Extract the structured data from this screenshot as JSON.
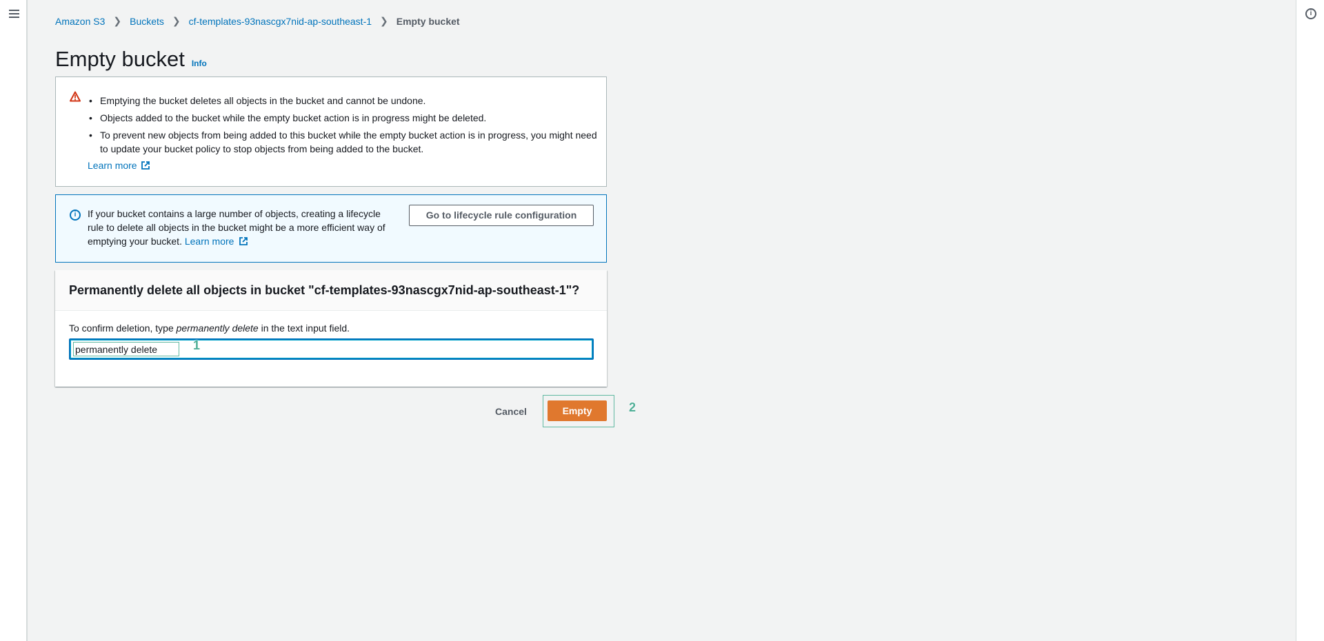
{
  "nav": {
    "menu_icon": "hamburger-menu-icon",
    "help_icon": "info-circle-icon"
  },
  "breadcrumb": [
    {
      "label": "Amazon S3"
    },
    {
      "label": "Buckets"
    },
    {
      "label": "cf-templates-93nascgx7nid-ap-southeast-1"
    },
    {
      "label": "Empty bucket"
    }
  ],
  "header": {
    "title": "Empty bucket",
    "info_link": "Info"
  },
  "warning": {
    "icon": "warning-triangle-icon",
    "items": [
      "Emptying the bucket deletes all objects in the bucket and cannot be undone.",
      "Objects added to the bucket while the empty bucket action is in progress might be deleted.",
      "To prevent new objects from being added to this bucket while the empty bucket action is in progress, you might need to update your bucket policy to stop objects from being added to the bucket."
    ],
    "learn_more": "Learn more"
  },
  "info": {
    "icon": "info-circle-icon",
    "text": "If your bucket contains a large number of objects, creating a lifecycle rule to delete all objects in the bucket might be a more efficient way of emptying your bucket.",
    "learn_more": "Learn more",
    "button_label": "Go to lifecycle rule configuration"
  },
  "confirm_panel": {
    "title": "Permanently delete all objects in bucket \"cf-templates-93nascgx7nid-ap-southeast-1\"?",
    "label_prefix": "To confirm deletion, type ",
    "label_emphasis": "permanently delete",
    "label_suffix": " in the text input field.",
    "input_value": "permanently delete"
  },
  "actions": {
    "cancel_label": "Cancel",
    "empty_label": "Empty"
  },
  "annotations": {
    "marker_1": "1",
    "marker_2": "2"
  },
  "colors": {
    "link": "#0073bb",
    "primary_button": "#e0782e",
    "warning": "#d13212",
    "annotation": "#4fae96"
  }
}
